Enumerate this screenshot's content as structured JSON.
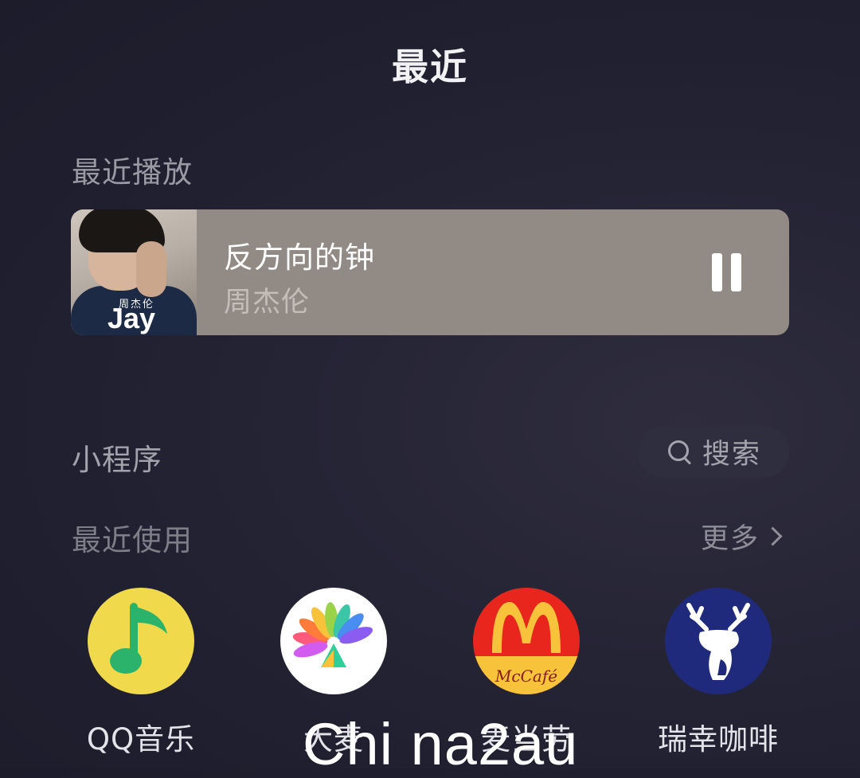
{
  "header": {
    "title": "最近"
  },
  "recent_play": {
    "section_label": "最近播放",
    "track": {
      "title": "反方向的钟",
      "artist": "周杰伦",
      "cover_small_text": "周杰伦",
      "cover_big_text": "Jay",
      "state": "playing"
    }
  },
  "mini_programs": {
    "section_label": "小程序",
    "search_label": "搜索",
    "recent_label": "最近使用",
    "more_label": "更多",
    "apps": [
      {
        "name": "QQ音乐",
        "icon": "qq-music-icon",
        "color": "#f1d94c"
      },
      {
        "name": "大麦",
        "icon": "damai-icon",
        "color": "#ffffff"
      },
      {
        "name": "麦当劳",
        "icon": "mcdonalds-icon",
        "color": "#e8261d",
        "logo_text": "McCafé"
      },
      {
        "name": "瑞幸咖啡",
        "icon": "luckin-coffee-icon",
        "color": "#1f2a7c"
      }
    ]
  },
  "watermark": {
    "text": "Chi na2au"
  },
  "colors": {
    "background": "#1f1f2f",
    "now_playing_card": "#928a85",
    "search_pill": "#2f2e3e"
  }
}
